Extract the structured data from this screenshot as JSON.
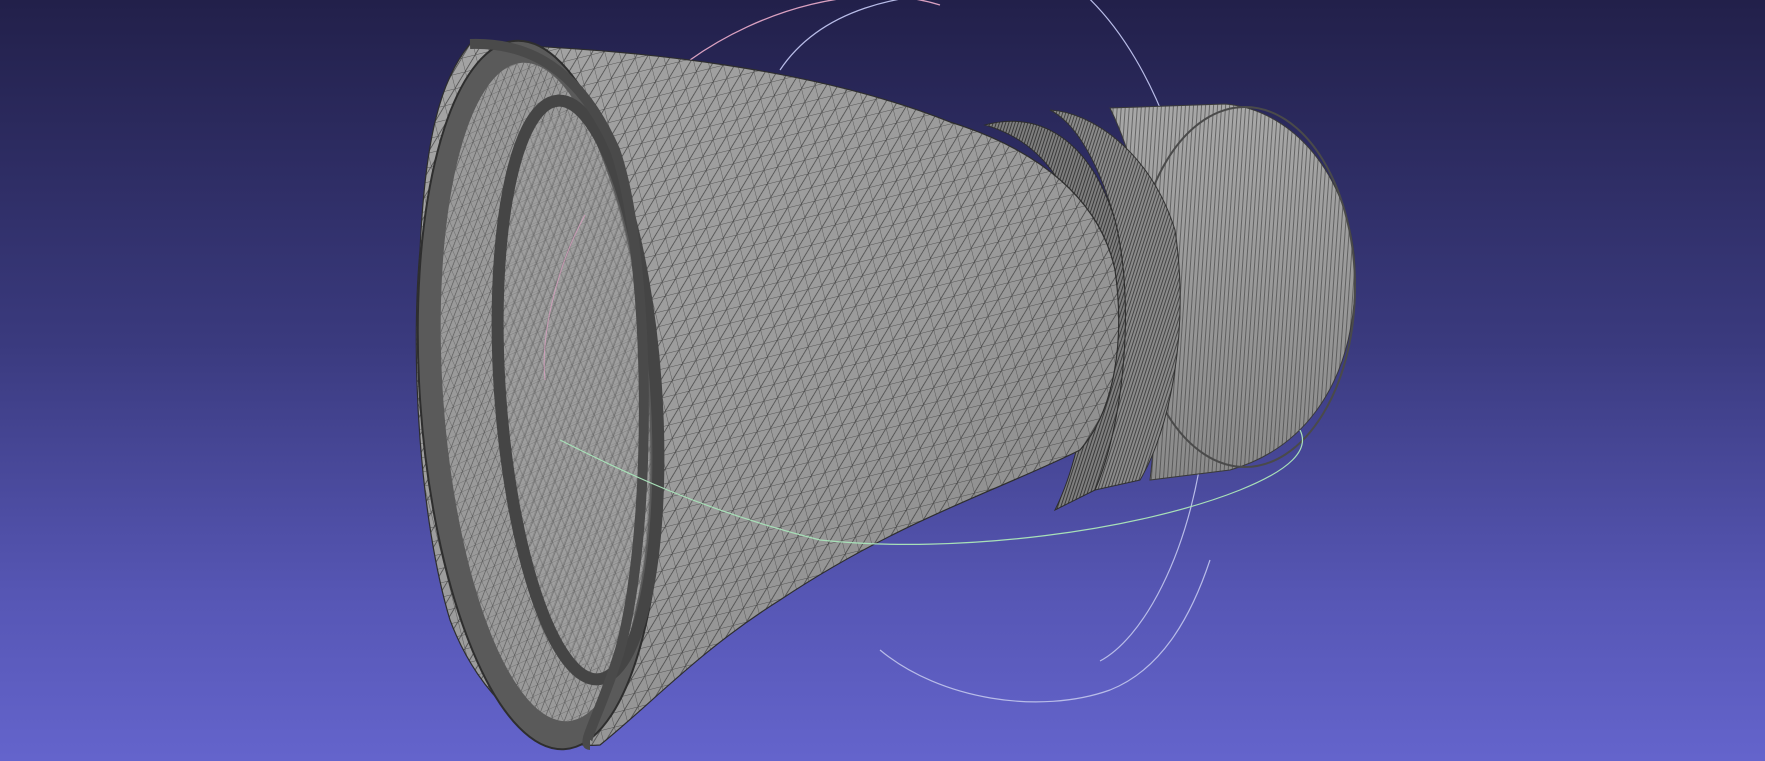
{
  "app": {
    "window_title": ""
  },
  "viewport": {
    "background_top": "#22204a",
    "background_bottom": "#6464cc",
    "mesh_fill": "#9b9b9b",
    "mesh_shade": "#7e7e7e",
    "mesh_edge": "#2e2e2e",
    "rim_dark": "#505050"
  },
  "trackball": {
    "ring_colors": [
      "#d9a0c0",
      "#a8e0b8",
      "#b8bce8"
    ]
  },
  "model": {
    "type": "triangle-mesh",
    "parts": [
      "nozzle-bell",
      "nozzle-throat",
      "combustion-chamber"
    ]
  }
}
